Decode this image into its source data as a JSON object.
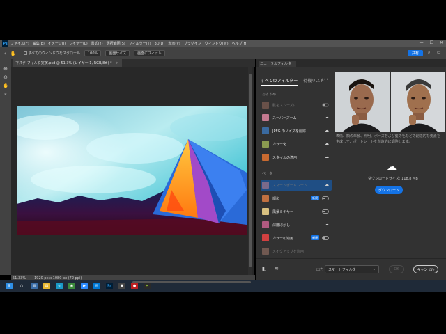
{
  "menubar": {
    "app_icon": "Ps",
    "items": [
      "ファイル(F)",
      "編集(E)",
      "イメージ(I)",
      "レイヤー(L)",
      "書式(Y)",
      "選択範囲(S)",
      "フィルター(T)",
      "3D(D)",
      "表示(V)",
      "プラグイン",
      "ウィンドウ(W)",
      "ヘルプ(H)"
    ],
    "window_controls": [
      "—",
      "☐",
      "✕"
    ]
  },
  "options_bar": {
    "checkbox_label": "すべてのウィンドウをスクロール",
    "zoom_button": "100%",
    "fit_button": "画面サイズ",
    "fill_button": "画面にフィット",
    "share_button": "共有"
  },
  "document": {
    "tab_title": "マスク-フィルタ実演.psd @ 51.3% (レイヤー 1, RGB/8#) *",
    "tab_close": "×",
    "zoom": "51.33%",
    "info": "1920 px x 1080 px (72 ppi)"
  },
  "neural_filters": {
    "panel_title": "ニューラルフィルター",
    "tabs": [
      "すべてのフィルター",
      "待機リスト"
    ],
    "more": "•••",
    "featured_label": "おすすめ",
    "beta_label": "ベータ",
    "featured": [
      {
        "label": "肌をスムーズに",
        "dim": true,
        "control": "toggle"
      },
      {
        "label": "スーパーズーム",
        "dim": false,
        "control": "cloud"
      },
      {
        "label": "JPEG のノイズを削除",
        "dim": false,
        "control": "cloud"
      },
      {
        "label": "カラー化",
        "dim": false,
        "control": "cloud"
      },
      {
        "label": "スタイルの適用",
        "dim": false,
        "control": "cloud"
      }
    ],
    "beta": [
      {
        "label": "スマートポートレート",
        "dim": true,
        "control": "cloud",
        "selected": true
      },
      {
        "label": "調和",
        "dim": false,
        "control": "toggle",
        "badge": "新規"
      },
      {
        "label": "風景ミキサー",
        "dim": false,
        "control": "toggle"
      },
      {
        "label": "深度ぼかし",
        "dim": false,
        "control": "cloud"
      },
      {
        "label": "カラーの適用",
        "dim": false,
        "control": "toggle",
        "badge": "新規"
      },
      {
        "label": "メイクアップを適用",
        "dim": true,
        "control": "cloud"
      }
    ],
    "description": "表情、顔の年齢、照明、ポーズおよび髪の毛などの創造的な要素を生成して、ポートレートを創造的に調整します。",
    "download_size": "ダウンロードサイズ: 118.8 MB",
    "download_button": "ダウンロード",
    "output_label": "出力",
    "output_value": "スマートフィルター",
    "ok_button": "OK",
    "cancel_button": "キャンセル"
  },
  "colors": {
    "accent": "#1473e6",
    "selected_row": "#1f4e84",
    "panel_bg": "#323232"
  }
}
